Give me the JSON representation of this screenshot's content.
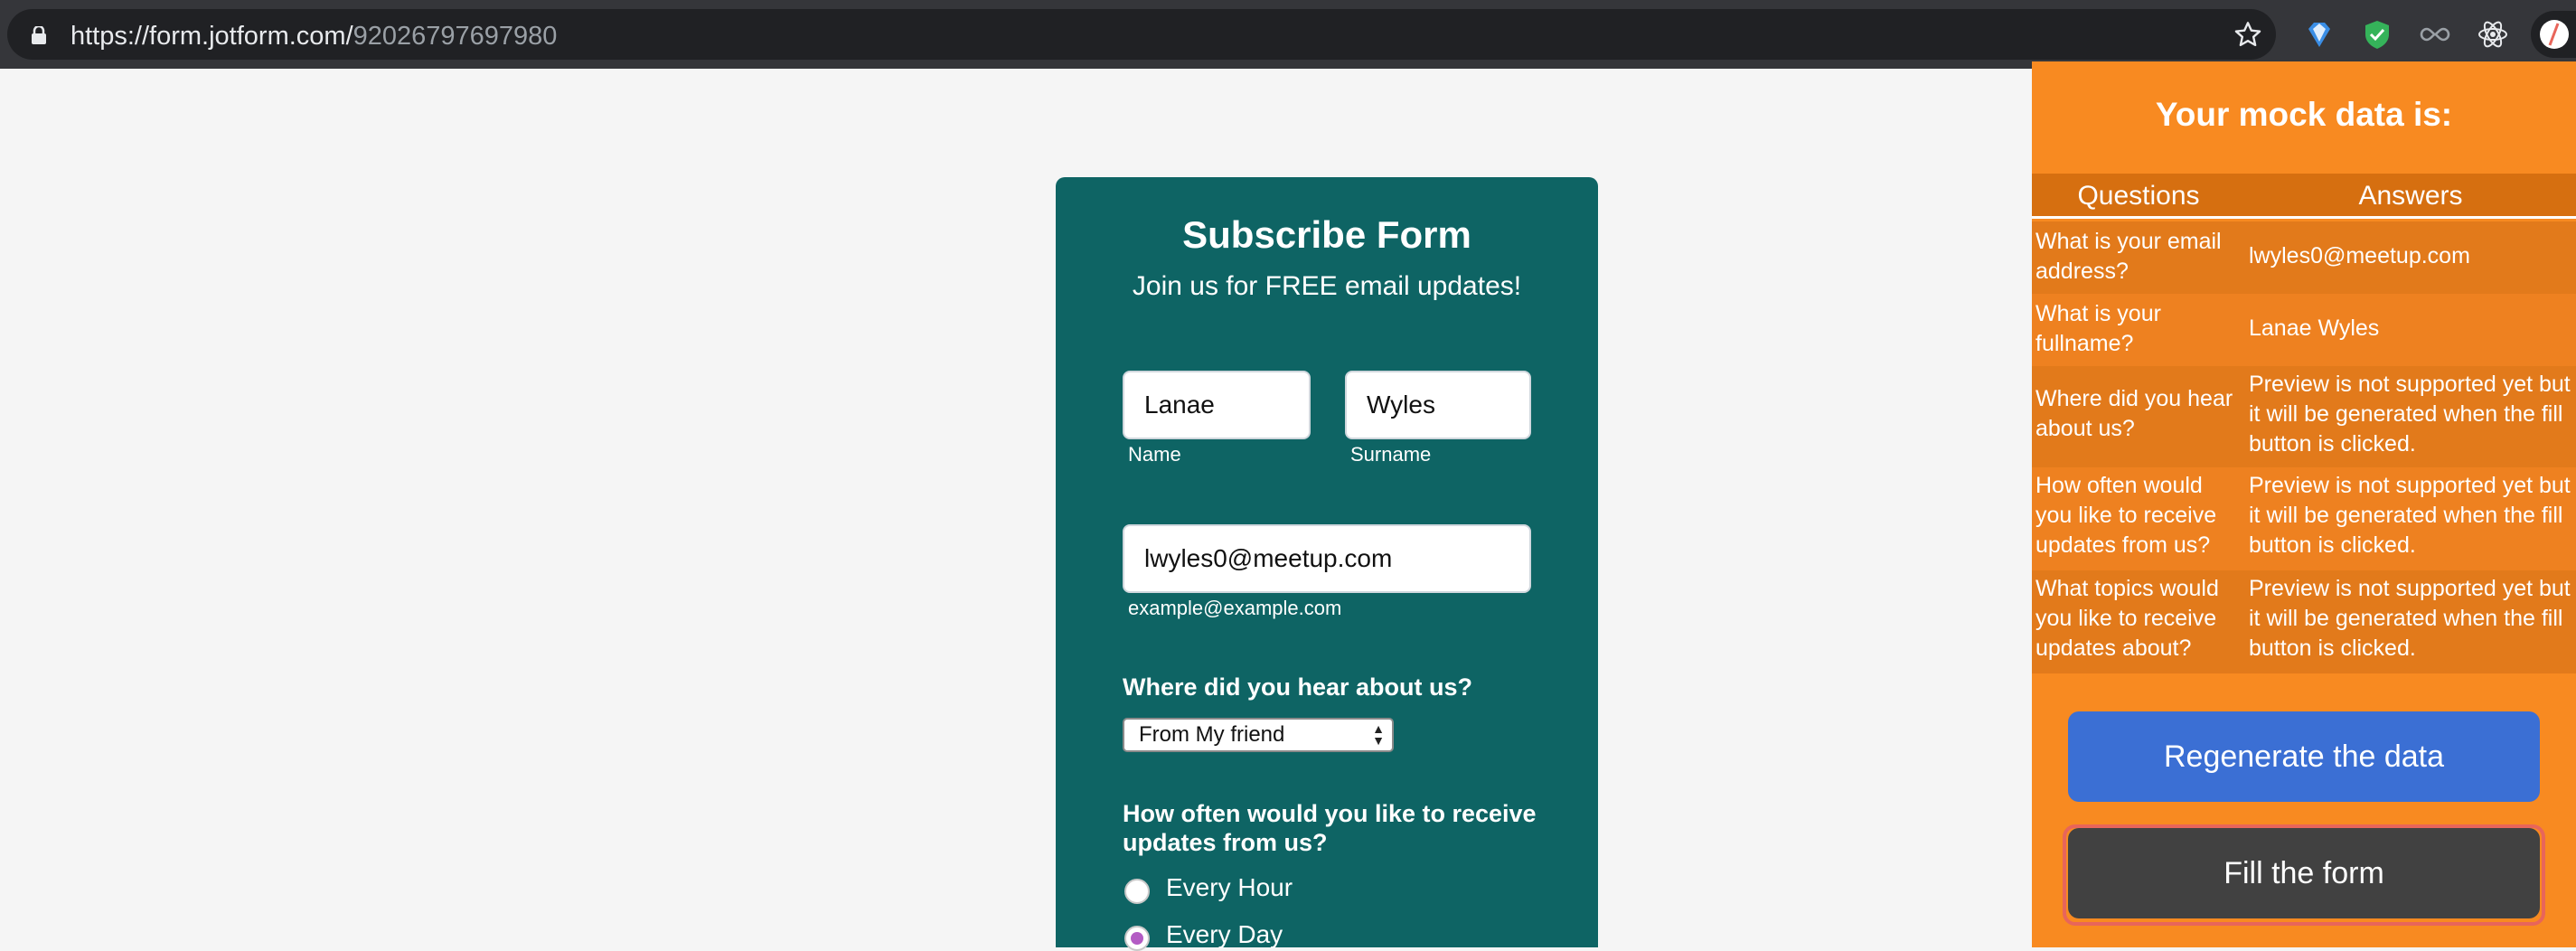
{
  "browser": {
    "url_host": "https://form.jotform.com/",
    "url_path": "92026797697980",
    "icons": [
      "lock-icon",
      "star-icon",
      "gem-extension-icon",
      "shield-extension-icon",
      "infinity-extension-icon",
      "react-extension-icon",
      "mock-data-extension-icon"
    ]
  },
  "form": {
    "title": "Subscribe Form",
    "subtitle": "Join us for FREE email updates!",
    "first_name": "Lanae",
    "first_name_label": "Name",
    "surname": "Wyles",
    "surname_label": "Surname",
    "email": "lwyles0@meetup.com",
    "email_hint": "example@example.com",
    "q_hear": "Where did you hear about us?",
    "hear_selected": "From My friend",
    "q_often": "How often would you like to receive updates from us?",
    "options": [
      {
        "label": "Every Hour",
        "checked": false
      },
      {
        "label": "Every Day",
        "checked": true
      }
    ]
  },
  "panel": {
    "title": "Your mock data is:",
    "col_questions": "Questions",
    "col_answers": "Answers",
    "rows": [
      {
        "q": "What is your email address?",
        "a": "lwyles0@meetup.com"
      },
      {
        "q": "What is your fullname?",
        "a": "Lanae Wyles"
      },
      {
        "q": "Where did you hear about us?",
        "a": "Preview is not supported yet but it will be generated when the fill button is clicked."
      },
      {
        "q": "How often would you like to receive updates from us?",
        "a": "Preview is not supported yet but it will be generated when the fill button is clicked."
      },
      {
        "q": "What topics would you like to receive updates about?",
        "a": "Preview is not supported yet but it will be generated when the fill button is clicked."
      }
    ],
    "regenerate_label": "Regenerate the data",
    "fill_label": "Fill the form"
  },
  "colors": {
    "form_bg": "#0e6464",
    "panel_bg": "#f88a21",
    "regenerate_btn": "#3b6fd4",
    "fill_btn": "#414141",
    "radio_checked": "#b35cc4"
  }
}
